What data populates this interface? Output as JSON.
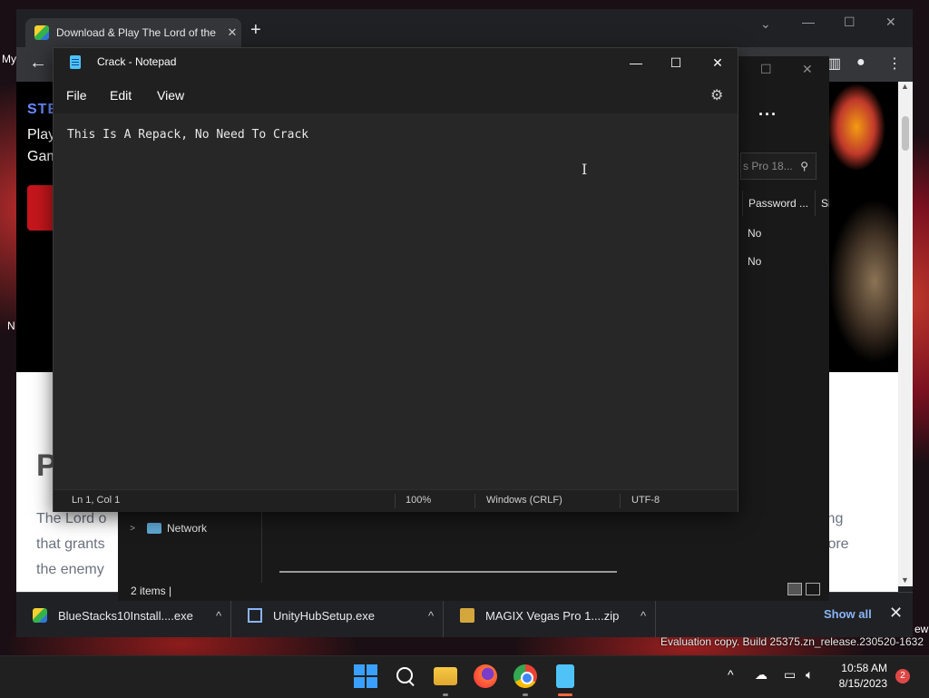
{
  "desktop": {
    "left_labels": [
      "My",
      "N"
    ],
    "right_label": "ew",
    "watermark": "Evaluation copy. Build 25375.zn_release.230520-1632"
  },
  "browser": {
    "tab_title": "Download & Play The Lord of the",
    "tab_close": "✕",
    "new_tab": "+",
    "page": {
      "strip_label": "STE",
      "hero_line1": "Play",
      "hero_line2": "Gam",
      "heading": "P",
      "body_line1_left": "The Lord o",
      "body_line2_left": "that grants",
      "body_line3_left": "the enemy",
      "body_line1_right": "ing",
      "body_line2_right": "fore"
    },
    "downloads": [
      {
        "label": "BlueStacks10Install....exe",
        "icon": "bluestacks-icon"
      },
      {
        "label": "UnityHubSetup.exe",
        "icon": "installer-icon"
      },
      {
        "label": "MAGIX Vegas Pro 1....zip",
        "icon": "zip-icon"
      }
    ],
    "show_all": "Show all",
    "close": "✕"
  },
  "explorer": {
    "search_placeholder": "s Pro 18...",
    "columns": [
      "Password ...",
      "Si"
    ],
    "rows": [
      {
        "password": "No"
      },
      {
        "password": "No"
      }
    ],
    "nav_network": "Network",
    "status": "2 items  |"
  },
  "notepad": {
    "title": "Crack - Notepad",
    "menu": [
      "File",
      "Edit",
      "View"
    ],
    "content": "This Is A Repack, No Need To Crack",
    "status": {
      "position": "Ln 1, Col 1",
      "zoom": "100%",
      "line_ending": "Windows (CRLF)",
      "encoding": "UTF-8"
    }
  },
  "taskbar": {
    "apps": [
      "start-icon",
      "search-icon",
      "file-explorer-icon",
      "firefox-icon",
      "chrome-icon",
      "notepad-icon"
    ],
    "time": "10:58 AM",
    "date": "8/15/2023",
    "notification_count": "2"
  },
  "colors": {
    "notepad_bg": "#202020",
    "editor_bg": "#272727",
    "accent": "#8ab4f8",
    "taskbar_active": "#ff6a3d"
  }
}
